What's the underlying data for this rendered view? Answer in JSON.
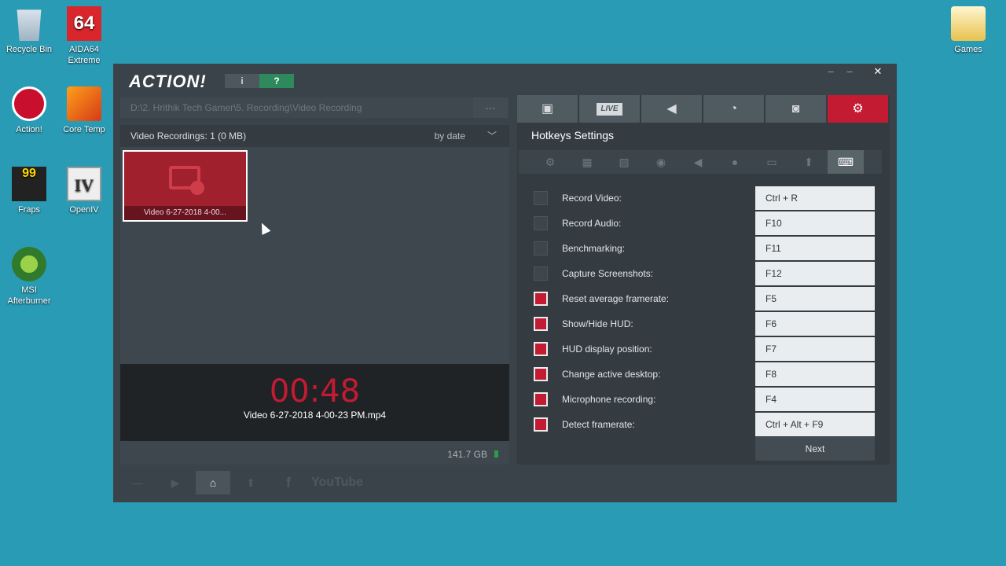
{
  "desktop": {
    "icons": [
      {
        "label": "Recycle Bin"
      },
      {
        "label": "AIDA64 Extreme",
        "glyph": "64"
      },
      {
        "label": "Action!"
      },
      {
        "label": "Core Temp"
      },
      {
        "label": "Fraps",
        "glyph": "99"
      },
      {
        "label": "OpenIV",
        "glyph": "IV"
      },
      {
        "label": "MSI Afterburner"
      },
      {
        "label": "Games"
      }
    ]
  },
  "app": {
    "logo": "ACTION!",
    "info_icon": "info-icon",
    "help_icon": "help-icon",
    "window_controls": {
      "close": "✕",
      "maximize": "–",
      "minimize": "–"
    }
  },
  "left": {
    "path": "D:\\2. Hrithik Tech Gamer\\5. Recording\\Video Recording",
    "path_more": "...",
    "recordings_header": "Video Recordings: 1 (0 MB)",
    "sort": "by date",
    "thumbnail_label": "Video 6-27-2018 4-00...",
    "timer": "00:48",
    "filename": "Video 6-27-2018 4-00-23 PM.mp4",
    "storage": "141.7 GB",
    "bottom_buttons": [
      "minus-icon",
      "play-icon",
      "folder-icon",
      "upload-icon",
      "facebook-icon"
    ],
    "youtube": "YouTube"
  },
  "right": {
    "tabs": [
      {
        "icon": "video-record-icon"
      },
      {
        "label": "LIVE"
      },
      {
        "icon": "speaker-icon"
      },
      {
        "icon": "stopwatch-icon"
      },
      {
        "icon": "camera-icon"
      },
      {
        "icon": "gear-icon",
        "active": true
      }
    ],
    "title": "Hotkeys Settings",
    "subtabs": [
      "gear-icon",
      "film-icon",
      "image-icon",
      "webcam-icon",
      "speaker-icon",
      "microphone-icon",
      "screen-icon",
      "upload-icon",
      "keyboard-icon"
    ],
    "hotkeys": [
      {
        "label": "Record Video:",
        "key": "Ctrl + R",
        "checked": false
      },
      {
        "label": "Record Audio:",
        "key": "F10",
        "checked": false
      },
      {
        "label": "Benchmarking:",
        "key": "F11",
        "checked": false
      },
      {
        "label": "Capture Screenshots:",
        "key": "F12",
        "checked": false
      },
      {
        "label": "Reset average framerate:",
        "key": "F5",
        "checked": true
      },
      {
        "label": "Show/Hide HUD:",
        "key": "F6",
        "checked": true
      },
      {
        "label": "HUD display position:",
        "key": "F7",
        "checked": true
      },
      {
        "label": "Change active desktop:",
        "key": "F8",
        "checked": true
      },
      {
        "label": "Microphone recording:",
        "key": "F4",
        "checked": true
      },
      {
        "label": "Detect framerate:",
        "key": "Ctrl + Alt + F9",
        "checked": true
      }
    ],
    "next_label": "Next"
  },
  "colors": {
    "desktop": "#2a9bb5",
    "accent": "#c21b32",
    "panel": "#3a434a"
  }
}
